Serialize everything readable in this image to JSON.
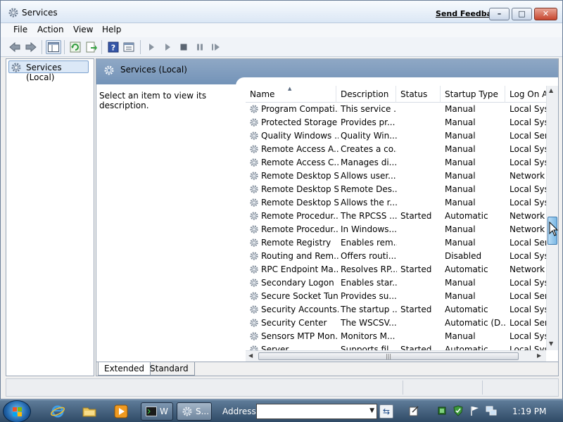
{
  "window": {
    "title": "Services",
    "send_feedback": "Send Feedback",
    "minimize": "–",
    "maximize": "□",
    "close": "✕"
  },
  "menu": [
    "File",
    "Action",
    "View",
    "Help"
  ],
  "tree": {
    "root": "Services (Local)"
  },
  "detail": {
    "header": "Services (Local)",
    "description_prompt": "Select an item to view its description."
  },
  "columns": [
    "Name",
    "Description",
    "Status",
    "Startup Type",
    "Log On A"
  ],
  "rows": [
    [
      "Program Compati...",
      "This service ...",
      "",
      "Manual",
      "Local Syst"
    ],
    [
      "Protected Storage",
      "Provides pr...",
      "",
      "Manual",
      "Local Syst"
    ],
    [
      "Quality Windows ...",
      "Quality Win...",
      "",
      "Manual",
      "Local Serv"
    ],
    [
      "Remote Access A...",
      "Creates a co...",
      "",
      "Manual",
      "Local Syst"
    ],
    [
      "Remote Access C...",
      "Manages di...",
      "",
      "Manual",
      "Local Syst"
    ],
    [
      "Remote Desktop S...",
      "Allows user...",
      "",
      "Manual",
      "Network S"
    ],
    [
      "Remote Desktop S...",
      "Remote Des...",
      "",
      "Manual",
      "Local Syst"
    ],
    [
      "Remote Desktop S...",
      "Allows the r...",
      "",
      "Manual",
      "Local Syst"
    ],
    [
      "Remote Procedur...",
      "The RPCSS ...",
      "Started",
      "Automatic",
      "Network S"
    ],
    [
      "Remote Procedur...",
      "In Windows...",
      "",
      "Manual",
      "Network S"
    ],
    [
      "Remote Registry",
      "Enables rem...",
      "",
      "Manual",
      "Local Serv"
    ],
    [
      "Routing and Rem...",
      "Offers routi...",
      "",
      "Disabled",
      "Local Syst"
    ],
    [
      "RPC Endpoint Ma...",
      "Resolves RP...",
      "Started",
      "Automatic",
      "Network S"
    ],
    [
      "Secondary Logon",
      "Enables star...",
      "",
      "Manual",
      "Local Syst"
    ],
    [
      "Secure Socket Tun...",
      "Provides su...",
      "",
      "Manual",
      "Local Serv"
    ],
    [
      "Security Accounts...",
      "The startup ...",
      "Started",
      "Automatic",
      "Local Syst"
    ],
    [
      "Security Center",
      "The WSCSV...",
      "",
      "Automatic (D...",
      "Local Serv"
    ],
    [
      "Sensors MTP Mon...",
      "Monitors M...",
      "",
      "Manual",
      "Local Syst"
    ],
    [
      "Server",
      "Supports fil...",
      "Started",
      "Automatic",
      "Local Syst"
    ]
  ],
  "tabs": [
    "Extended",
    "Standard"
  ],
  "taskbar": {
    "task1": "W",
    "task2": "S...",
    "address_label": "Address",
    "address_value": "",
    "clock": "1:19 PM"
  }
}
